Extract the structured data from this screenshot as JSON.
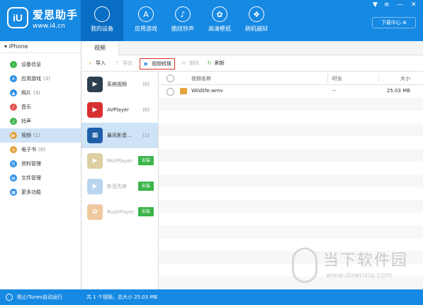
{
  "brand": {
    "name": "爱思助手",
    "url": "www.i4.cn",
    "logo": "iU"
  },
  "nav": [
    {
      "label": "我的设备",
      "icon": "apple-icon",
      "glyph": "",
      "active": true
    },
    {
      "label": "应用游戏",
      "icon": "appstore-icon",
      "glyph": "A"
    },
    {
      "label": "酷炫铃声",
      "icon": "music-icon",
      "glyph": "♪"
    },
    {
      "label": "高清壁纸",
      "icon": "flower-icon",
      "glyph": "✿"
    },
    {
      "label": "刷机越狱",
      "icon": "box-icon",
      "glyph": "❖"
    }
  ],
  "download_center": "下载中心",
  "device": "iPhone",
  "sidebar": [
    {
      "label": "设备信息",
      "count": "",
      "color": "#3bb54a",
      "icon": "info-icon",
      "glyph": "i"
    },
    {
      "label": "应用游戏",
      "count": "(3)",
      "color": "#2d8ee8",
      "icon": "appstore-icon",
      "glyph": "A"
    },
    {
      "label": "照片",
      "count": "(3)",
      "color": "#2d8ee8",
      "icon": "photo-icon",
      "glyph": "▲"
    },
    {
      "label": "音乐",
      "count": "",
      "color": "#e65050",
      "icon": "music-icon",
      "glyph": "♪"
    },
    {
      "label": "铃声",
      "count": "",
      "color": "#3bb54a",
      "icon": "bell-icon",
      "glyph": "♫"
    },
    {
      "label": "视频",
      "count": "(1)",
      "color": "#e6a23c",
      "icon": "video-icon",
      "glyph": "▶",
      "selected": true
    },
    {
      "label": "电子书",
      "count": "(0)",
      "color": "#e6a23c",
      "icon": "book-icon",
      "glyph": "≡"
    },
    {
      "label": "资料管理",
      "count": "",
      "color": "#2d8ee8",
      "icon": "contacts-icon",
      "glyph": "☰"
    },
    {
      "label": "文件管理",
      "count": "",
      "color": "#2d8ee8",
      "icon": "file-icon",
      "glyph": "▤"
    },
    {
      "label": "更多功能",
      "count": "",
      "color": "#2d8ee8",
      "icon": "grid-icon",
      "glyph": "▦"
    }
  ],
  "tab": "视频",
  "toolbar": {
    "import": "导入",
    "export": "导出",
    "convert": "视频转换",
    "delete": "删除",
    "refresh": "刷新"
  },
  "apps": [
    {
      "name": "系统视频",
      "count": "(0)",
      "color": "#2d3e50",
      "glyph": "▶",
      "icon": "system-video-icon"
    },
    {
      "name": "AVPlayer",
      "count": "(0)",
      "color": "#d83030",
      "glyph": "▶",
      "icon": "avplayer-icon"
    },
    {
      "name": "暴风影音...",
      "count": "(1)",
      "color": "#1e5fa8",
      "glyph": "▦",
      "icon": "baofeng-icon",
      "selected": true
    },
    {
      "name": "MoliPlayer",
      "install": "安装",
      "color": "#dccfa0",
      "glyph": "▶",
      "icon": "moliplayer-icon"
    },
    {
      "name": "影音先锋",
      "install": "安装",
      "color": "#b8d4ee",
      "glyph": "▶",
      "icon": "yingyin-icon"
    },
    {
      "name": "RushPlayer",
      "install": "安装",
      "color": "#f0c8a0",
      "glyph": "✿",
      "icon": "rushplayer-icon"
    }
  ],
  "table": {
    "headers": {
      "name": "视频名称",
      "duration": "时长",
      "size": "大小"
    },
    "rows": [
      {
        "name": "Wildlife.wmv",
        "duration": "--",
        "size": "25.03 MB"
      }
    ]
  },
  "status": {
    "left": "阻止iTunes自动运行",
    "summary": "共 1 个视频，总大小 25.03 MB"
  },
  "watermark": {
    "title": "当下软件园",
    "url": "www.downxia.com"
  }
}
